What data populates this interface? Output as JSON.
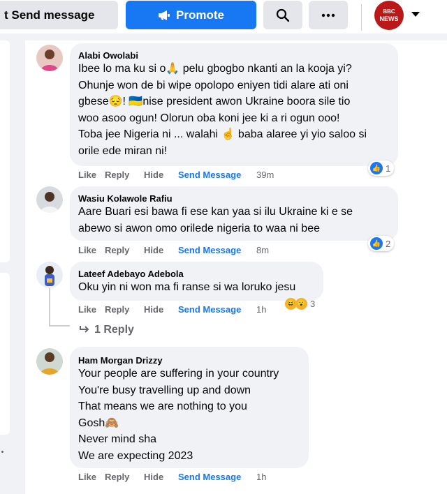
{
  "topbar": {
    "send_message_label": "t Send message",
    "promote_label": "Promote",
    "search_icon": "search-icon",
    "more_icon": "more-icon",
    "profile": {
      "logo_line1": "BBC",
      "logo_line2": "NEWS"
    }
  },
  "colors": {
    "brand": "#1877f2",
    "bbc_red": "#bb1919",
    "bubble": "#f0f2f5",
    "meta": "#65676b"
  },
  "comments": [
    {
      "author": "Alabi Owolabi",
      "lines": [
        "Ibee lo ma ku si o🙏 pelu gbogbo nkanti an la kooja yi?",
        "Ohunje won de bi wipe opolopo eniyen tidi alare ati oni",
        "gbese😔! 🇺🇦nise president awon Ukraine boora sile tio",
        "woo asoo ogun! Olorun oba koni jee ki a ri ogun ooo!",
        "Toba jee Nigeria ni ... walahi ☝️ baba alaree yi yio saloo si",
        "orile ede miran ni!"
      ],
      "actions": {
        "like": "Like",
        "reply": "Reply",
        "hide": "Hide",
        "send": "Send Message",
        "time": "39m"
      },
      "reaction_count": "1"
    },
    {
      "author": "Wasiu Kolawole Rafiu",
      "lines": [
        "Aare Buari esi bawa fi ese kan yaa si ilu Ukraine ki e se",
        "abewo si awon omo orilede nigeria to waa ni bee"
      ],
      "actions": {
        "like": "Like",
        "reply": "Reply",
        "hide": "Hide",
        "send": "Send Message",
        "time": "8m"
      },
      "reaction_count": "2"
    },
    {
      "author": "Lateef Adebayo Adebola",
      "lines": [
        "Oku yin ni won ma fi ranse si wa loruko jesu"
      ],
      "actions": {
        "like": "Like",
        "reply": "Reply",
        "hide": "Hide",
        "send": "Send Message",
        "time": "1h"
      },
      "reaction_count": "3",
      "replies_label": "1 Reply"
    },
    {
      "author": "Ham Morgan Drizzy",
      "lines": [
        "Your people are suffering in your country",
        "You're busy travelling up and down",
        "That means we are nothing to you",
        "Gosh🙈",
        "Never mind sha",
        "We are expecting 2023"
      ],
      "actions": {
        "like": "Like",
        "reply": "Reply",
        "hide": "Hide",
        "send": "Send Message",
        "time": "1h"
      }
    }
  ]
}
